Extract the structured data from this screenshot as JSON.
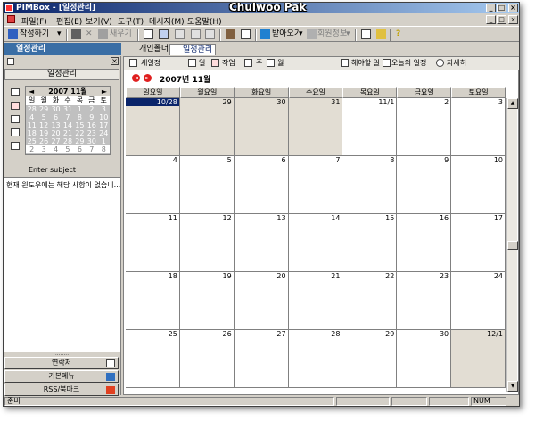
{
  "window": {
    "title": "PIMBox - [일정관리]",
    "watermark": "Chulwoo Pak"
  },
  "title_buttons": {
    "minimize": "_",
    "maximize": "□",
    "close": "×"
  },
  "menu": [
    "파일(F)",
    "편집(E)",
    "보기(V)",
    "도구(T)",
    "메시지(M)",
    "도움말(H)"
  ],
  "toolbar": {
    "compose_label": "작성하기",
    "reply_label": "새우기",
    "receive_label": "받아오기",
    "member_label": "회원정보"
  },
  "sidebar": {
    "header": "일정관리",
    "panel_title": "일정관리",
    "minical": {
      "month_label": "2007 11월",
      "prev": "◄",
      "next": "►",
      "dows": [
        "일",
        "월",
        "화",
        "수",
        "목",
        "금",
        "토"
      ],
      "weeks": [
        [
          "28",
          "29",
          "30",
          "31",
          "1",
          "2",
          "3"
        ],
        [
          "4",
          "5",
          "6",
          "7",
          "8",
          "9",
          "10"
        ],
        [
          "11",
          "12",
          "13",
          "14",
          "15",
          "16",
          "17"
        ],
        [
          "18",
          "19",
          "20",
          "21",
          "22",
          "23",
          "24"
        ],
        [
          "25",
          "26",
          "27",
          "28",
          "29",
          "30",
          "1"
        ],
        [
          "2",
          "3",
          "4",
          "5",
          "6",
          "7",
          "8"
        ]
      ]
    },
    "enter_subject": "Enter subject",
    "message": "현재 원도우에는 해당 사항이 없습니...",
    "buttons": [
      "연락처",
      "기본메뉴",
      "RSS/북마크"
    ]
  },
  "tabs": [
    "개인폴더",
    "일정관리"
  ],
  "viewbar": {
    "new_schedule": "새일정",
    "day": "일",
    "work": "작업",
    "week": "주",
    "month": "월",
    "todo": "해야할 일",
    "today_schedule": "오늘의 일정",
    "detail": "자세히"
  },
  "calendar": {
    "month_title": "2007년 11월",
    "dows": [
      "일요일",
      "월요일",
      "화요일",
      "수요일",
      "목요일",
      "금요일",
      "토요일"
    ],
    "weeks": [
      [
        "10/28",
        "29",
        "30",
        "31",
        "11/1",
        "2",
        "3"
      ],
      [
        "4",
        "5",
        "6",
        "7",
        "8",
        "9",
        "10"
      ],
      [
        "11",
        "12",
        "13",
        "14",
        "15",
        "16",
        "17"
      ],
      [
        "18",
        "19",
        "20",
        "21",
        "22",
        "23",
        "24"
      ],
      [
        "25",
        "26",
        "27",
        "28",
        "29",
        "30",
        "12/1"
      ]
    ]
  },
  "status": {
    "ready": "준비",
    "num": "NUM"
  },
  "colors": {
    "titlebar": "#0a246a",
    "sidebar_header": "#3a6ea5",
    "other_month": "#e2ddd3",
    "nav_arrow": "#e02020"
  }
}
